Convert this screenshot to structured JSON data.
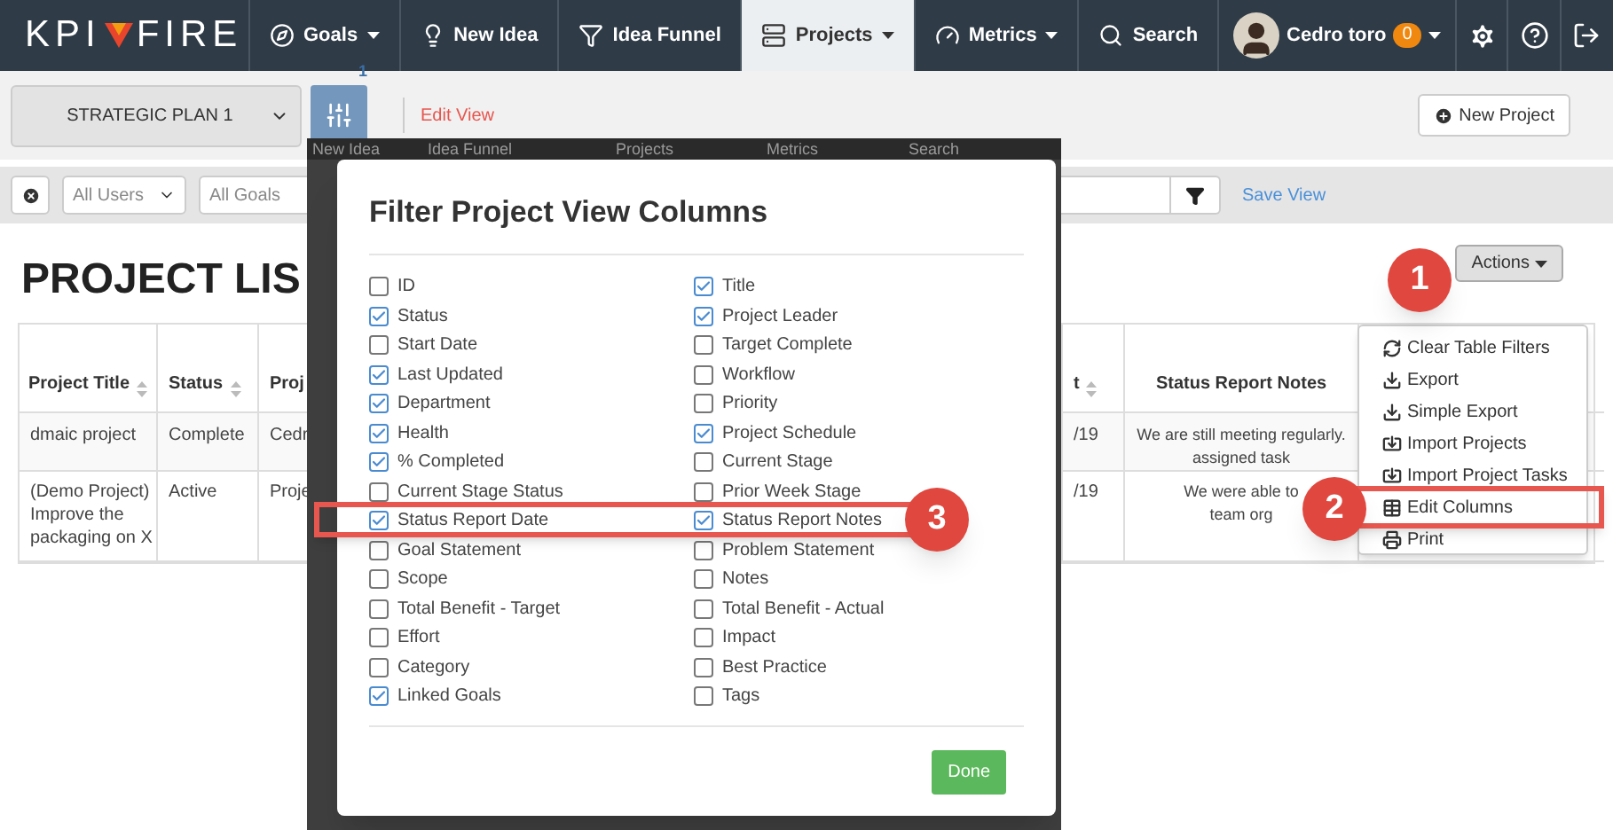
{
  "nav": {
    "logo": [
      "KPI",
      "FIRE"
    ],
    "items": [
      {
        "label": "Goals",
        "dropdown": true,
        "selected": false
      },
      {
        "label": "New Idea",
        "dropdown": false,
        "selected": false
      },
      {
        "label": "Idea Funnel",
        "dropdown": false,
        "selected": false
      },
      {
        "label": "Projects",
        "dropdown": true,
        "selected": true
      },
      {
        "label": "Metrics",
        "dropdown": true,
        "selected": false
      },
      {
        "label": "Search",
        "dropdown": false,
        "selected": false
      }
    ],
    "user": {
      "name": "Cedro toro",
      "badge": "0"
    }
  },
  "toolbar": {
    "plan_select": "STRATEGIC PLAN 1",
    "view_badge": "1",
    "edit_view": "Edit View",
    "new_project": "New Project"
  },
  "filters": {
    "users": "All Users",
    "goals": "All Goals",
    "save_view": "Save View"
  },
  "page_title": "PROJECT LIS",
  "actions": {
    "label": "Actions",
    "menu": [
      "Clear Table Filters",
      "Export",
      "Simple Export",
      "Import Projects",
      "Import Project Tasks",
      "Edit Columns",
      "Print"
    ]
  },
  "table": {
    "columns": [
      {
        "label": "Project Title",
        "sortable": true
      },
      {
        "label": "Status",
        "sortable": true
      },
      {
        "label": "Proj",
        "sortable": false
      },
      {
        "label": "t",
        "sortable": true
      },
      {
        "label": "Status Report Notes",
        "sortable": false
      }
    ],
    "rows": [
      [
        "dmaic project",
        "Complete",
        "Cedr",
        "/19",
        [
          "We are still meeting regularly.",
          "assigned task"
        ]
      ],
      [
        "(Demo Project) Improve the packaging on X",
        "Active",
        "Proje",
        "/19",
        [
          "We were able to",
          "team org"
        ]
      ]
    ]
  },
  "backdrop_nav": [
    "New Idea",
    "Idea Funnel",
    "Projects",
    "Metrics",
    "Search"
  ],
  "modal": {
    "title": "Filter Project View Columns",
    "option_columns": [
      [
        {
          "label": "ID",
          "checked": false
        },
        {
          "label": "Status",
          "checked": true
        },
        {
          "label": "Start Date",
          "checked": false
        },
        {
          "label": "Last Updated",
          "checked": true
        },
        {
          "label": "Department",
          "checked": true
        },
        {
          "label": "Health",
          "checked": true
        },
        {
          "label": "% Completed",
          "checked": true
        },
        {
          "label": "Current Stage Status",
          "checked": false
        },
        {
          "label": "Status Report Date",
          "checked": true
        },
        {
          "label": "Goal Statement",
          "checked": false
        },
        {
          "label": "Scope",
          "checked": false
        },
        {
          "label": "Total Benefit - Target",
          "checked": false
        },
        {
          "label": "Effort",
          "checked": false
        },
        {
          "label": "Category",
          "checked": false
        },
        {
          "label": "Linked Goals",
          "checked": true
        }
      ],
      [
        {
          "label": "Title",
          "checked": true
        },
        {
          "label": "Project Leader",
          "checked": true
        },
        {
          "label": "Target Complete",
          "checked": false
        },
        {
          "label": "Workflow",
          "checked": false
        },
        {
          "label": "Priority",
          "checked": false
        },
        {
          "label": "Project Schedule",
          "checked": true
        },
        {
          "label": "Current Stage",
          "checked": false
        },
        {
          "label": "Prior Week Stage",
          "checked": false
        },
        {
          "label": "Status Report Notes",
          "checked": true
        },
        {
          "label": "Problem Statement",
          "checked": false
        },
        {
          "label": "Notes",
          "checked": false
        },
        {
          "label": "Total Benefit - Actual",
          "checked": false
        },
        {
          "label": "Impact",
          "checked": false
        },
        {
          "label": "Best Practice",
          "checked": false
        },
        {
          "label": "Tags",
          "checked": false
        }
      ]
    ],
    "done": "Done"
  },
  "callouts": [
    "1",
    "2",
    "3"
  ]
}
